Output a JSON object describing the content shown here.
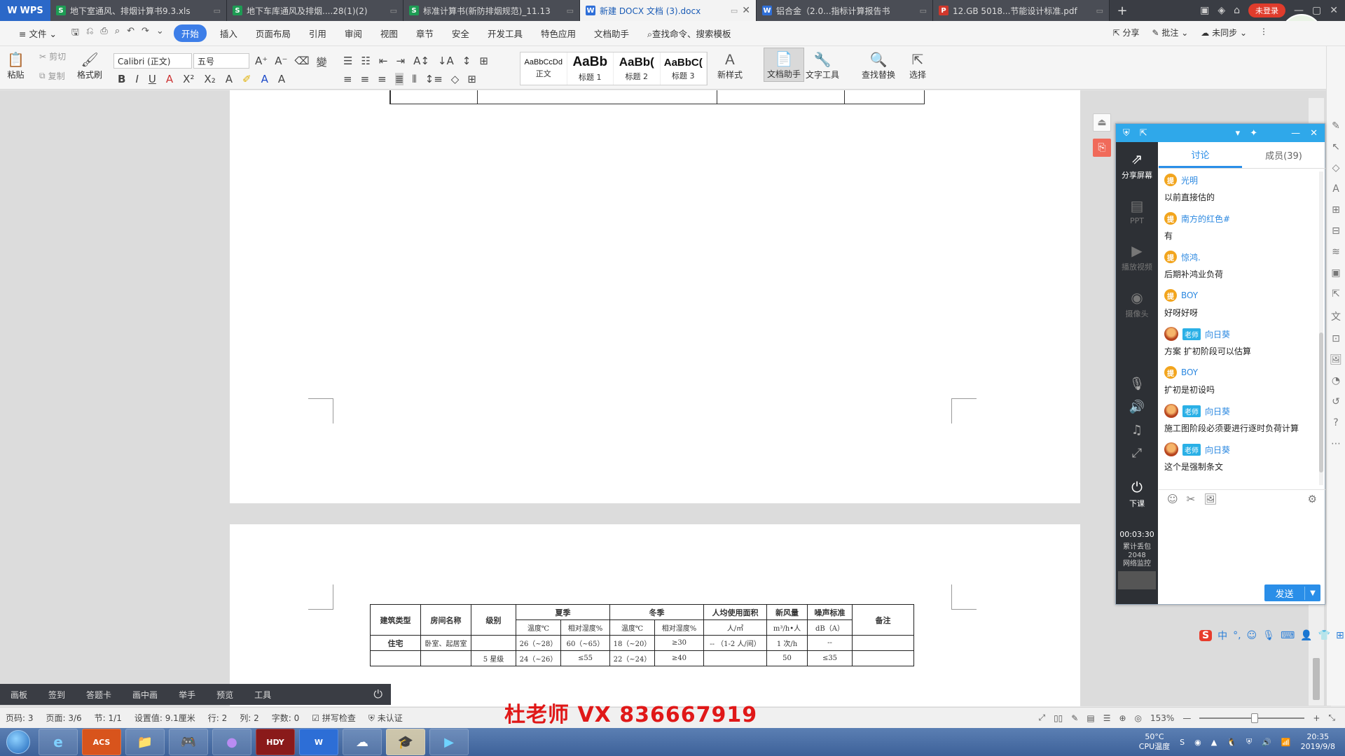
{
  "tabs": {
    "app": "WPS",
    "items": [
      {
        "icon": "S",
        "type": "s",
        "label": "地下室通风、排烟计算书9.3.xls"
      },
      {
        "icon": "S",
        "type": "s",
        "label": "地下车库通风及排烟....28(1)(2)"
      },
      {
        "icon": "S",
        "type": "s",
        "label": "标准计算书(新防排烟规范)_11.13"
      },
      {
        "icon": "W",
        "type": "w",
        "label": "新建 DOCX 文档 (3).docx",
        "active": true
      },
      {
        "icon": "W",
        "type": "w",
        "label": "铝合金（2.0...指标计算报告书"
      },
      {
        "icon": "P",
        "type": "p",
        "label": "12.GB 5018...节能设计标准.pdf"
      }
    ],
    "login": "未登录"
  },
  "menu": {
    "file": "文件",
    "items": [
      "开始",
      "插入",
      "页面布局",
      "引用",
      "审阅",
      "视图",
      "章节",
      "安全",
      "开发工具",
      "特色应用",
      "文档助手"
    ],
    "search": "查找命令、搜索模板",
    "share": "分享",
    "annotate": "批注",
    "sync": "未同步"
  },
  "ribbon": {
    "paste": "粘贴",
    "cut": "剪切",
    "copy": "复制",
    "format_painter": "格式刷",
    "font_name": "Calibri (正文)",
    "font_size": "五号",
    "styles": [
      {
        "preview": "AaBbCcDd",
        "label": "正文"
      },
      {
        "preview": "AaBb",
        "label": "标题 1"
      },
      {
        "preview": "AaBb(",
        "label": "标题 2"
      },
      {
        "preview": "AaBbC(",
        "label": "标题 3"
      }
    ],
    "new_style": "新样式",
    "doc_assistant": "文档助手",
    "text_tools": "文字工具",
    "find_replace": "查找替换",
    "select": "选择"
  },
  "table": {
    "header1": [
      "建筑类型",
      "房间名称",
      "级别",
      "夏季",
      "冬季",
      "人均使用面积",
      "新风量",
      "噪声标准",
      "备注"
    ],
    "header2": [
      "温度℃",
      "相对湿度%",
      "温度℃",
      "相对湿度%",
      "人/㎡",
      "m³/h•人",
      "dB（A）"
    ],
    "row1": [
      "住宅",
      "卧室、起居室",
      "",
      "26（~28）",
      "60（~65）",
      "18（~20）",
      "≥30",
      "-- （1-2 人/间）",
      "1 次/h",
      "--"
    ],
    "row2": [
      "5 星级",
      "",
      "",
      "22（~24）",
      "",
      "",
      "50",
      "≤35"
    ],
    "row3": [
      "24（~26）",
      "≤55",
      "≥40"
    ]
  },
  "chat": {
    "share_screen": "分享屏幕",
    "ppt": "PPT",
    "play_video": "播放视频",
    "camera": "摄像头",
    "end_class": "下课",
    "timer": "00:03:30",
    "stats_label": "累计丢包",
    "stats_value": "2048",
    "network": "网络监控",
    "tab_discuss": "讨论",
    "tab_members": "成员(39)",
    "messages": [
      {
        "name": "光明",
        "text": "以前直接估的",
        "role": "student"
      },
      {
        "name": "南方的红色#",
        "text": "有",
        "role": "student"
      },
      {
        "name": "惊鸿.",
        "text": "后期补鸿业负荷",
        "role": "student"
      },
      {
        "name": "BOY",
        "text": "好呀好呀",
        "role": "student"
      },
      {
        "name": "向日葵",
        "text": "方案 扩初阶段可以估算",
        "role": "teacher"
      },
      {
        "name": "BOY",
        "text": "扩初是初设吗",
        "role": "student"
      },
      {
        "name": "向日葵",
        "text": "施工图阶段必须要进行逐时负荷计算",
        "role": "teacher"
      },
      {
        "name": "向日葵",
        "text": "这个是强制条文",
        "role": "teacher"
      }
    ],
    "badge_student": "提",
    "teacher_tag": "老师",
    "send": "发送"
  },
  "floatbar": [
    "画板",
    "签到",
    "答题卡",
    "画中画",
    "举手",
    "预览",
    "工具"
  ],
  "status": {
    "page_no": "页码: 3",
    "pages": "页面: 3/6",
    "section": "节: 1/1",
    "setting": "设置值: 9.1厘米",
    "row": "行: 2",
    "col": "列: 2",
    "words": "字数: 0",
    "spell": "拼写检查",
    "cert": "未认证",
    "zoom": "153%"
  },
  "watermark": "杜老师 VX 836667919",
  "taskbar": {
    "apps": [
      "e",
      "ACS",
      "",
      "",
      "",
      "HDY",
      "W",
      "",
      "",
      ""
    ],
    "cpu_temp": "50°C",
    "cpu_label": "CPU温度",
    "time": "20:35",
    "date": "2019/9/8"
  }
}
